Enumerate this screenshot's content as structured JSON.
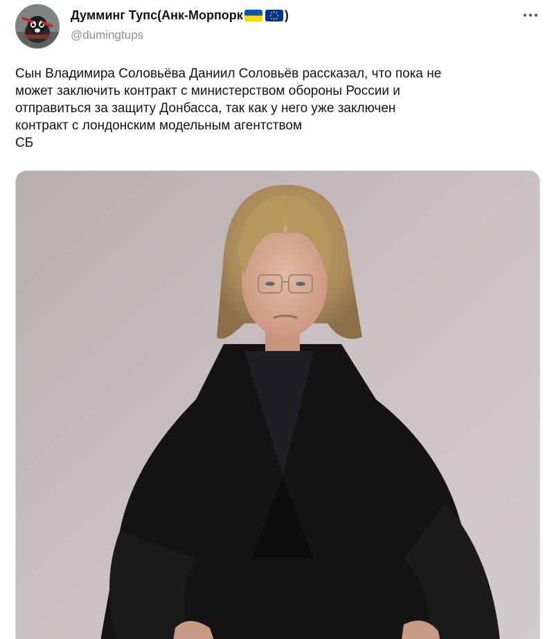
{
  "author": {
    "display_name": "Думминг Тупс(Анк-Морпорк",
    "username": "@dumingtups",
    "flags": [
      "ukraine-flag",
      "eu-flag"
    ],
    "verified": false
  },
  "actions": {
    "more_icon": "more-horizontal-icon"
  },
  "tweet": {
    "text": "Сын Владимира Соловьёва Даниил Соловьёв рассказал, что пока не\nможет заключить контракт с министерством обороны России и\nотправиться за защиту Донбасса, так как у него уже заключен\nконтракт с лондонским модельным агентством\nСБ"
  },
  "colors": {
    "text": "#0f1419",
    "secondary_text": "#8a8f94",
    "photo_background": "#c6b9b9",
    "suit": "#151316",
    "ukraine_blue": "#0057b7",
    "ukraine_yellow": "#ffd700",
    "eu_blue": "#003399"
  }
}
